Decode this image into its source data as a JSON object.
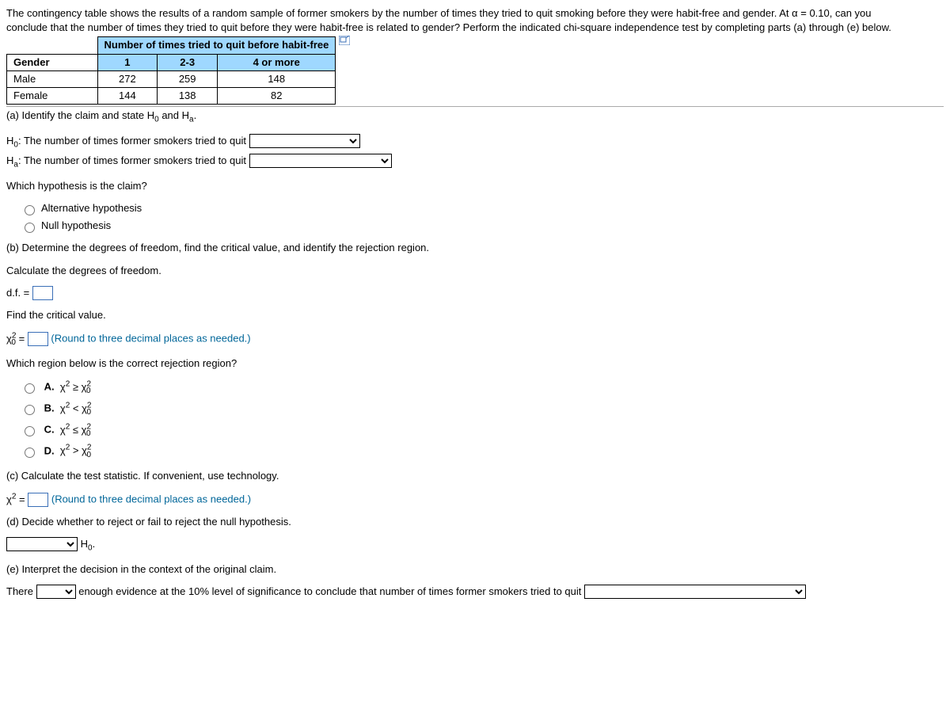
{
  "intro1": "The contingency table shows the results of a random sample of former smokers by the number of times they tried to quit smoking before they were habit-free and gender. At α = 0.10, can you",
  "intro2": "conclude that the number of times they tried to quit before they were habit-free is related to gender? Perform the indicated chi-square independence test by completing parts (a) through (e) below.",
  "table": {
    "title": "Number of times tried to quit before habit-free",
    "genderHeader": "Gender",
    "cols": [
      "1",
      "2-3",
      "4 or more"
    ],
    "rows": [
      {
        "label": "Male",
        "vals": [
          "272",
          "259",
          "148"
        ]
      },
      {
        "label": "Female",
        "vals": [
          "144",
          "138",
          "82"
        ]
      }
    ]
  },
  "a": {
    "prompt": "(a) Identify the claim and state H",
    "and": " and H",
    "dot": ".",
    "h0": "H",
    "h0text": ": The number of times former smokers tried to quit",
    "ha": "H",
    "hatext": ": The number of times former smokers tried to quit",
    "which": "Which hypothesis is the claim?",
    "opt1": "Alternative hypothesis",
    "opt2": "Null hypothesis"
  },
  "b": {
    "prompt": "(b) Determine the degrees of freedom, find the critical value, and identify the rejection region.",
    "calc": "Calculate the degrees of freedom.",
    "df": "d.f. =",
    "find": "Find the critical value.",
    "chi": " =",
    "round": "(Round to three decimal places as needed.)",
    "region": "Which region below is the correct rejection region?",
    "optA": "A.",
    "optB": "B.",
    "optC": "C.",
    "optD": "D."
  },
  "c": {
    "prompt": "(c) Calculate the test statistic. If convenient, use technology.",
    "chi": " =",
    "round": "(Round to three decimal places as needed.)"
  },
  "d": {
    "prompt": "(d) Decide whether to reject or fail to reject the null hypothesis.",
    "h0": " H",
    "dot": "."
  },
  "e": {
    "prompt": "(e) Interpret the decision in the context of the original claim.",
    "there": "There",
    "mid": "enough evidence at the 10% level of significance to conclude that number of times former smokers tried to quit"
  }
}
